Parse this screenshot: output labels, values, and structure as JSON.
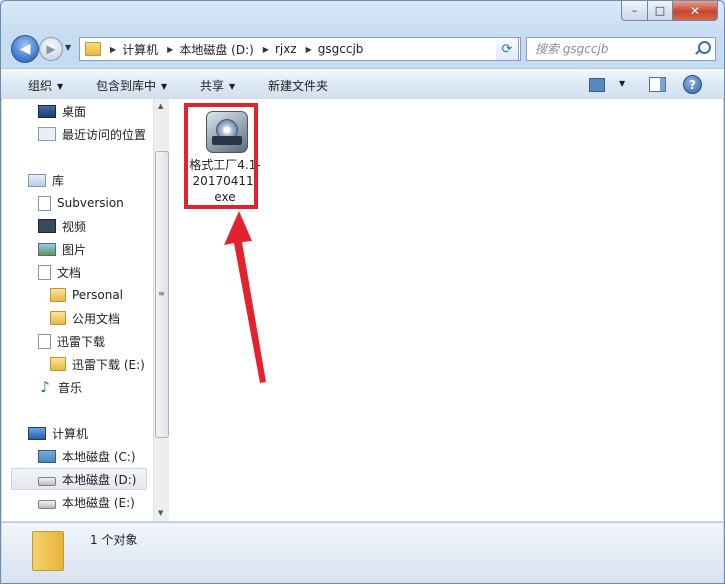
{
  "window": {
    "caption_min": "–",
    "caption_max": "□",
    "caption_close": "✕"
  },
  "nav": {
    "back": "◀",
    "forward": "▶",
    "breadcrumbs": [
      "计算机",
      "本地磁盘 (D:)",
      "rjxz",
      "gsgccjb"
    ],
    "search_placeholder": "搜索 gsgccjb"
  },
  "toolbar": {
    "organize": "组织",
    "include_in_library": "包含到库中",
    "share": "共享",
    "new_folder": "新建文件夹"
  },
  "sidebar": {
    "items": [
      {
        "label": "桌面",
        "icon": "desktop-icon"
      },
      {
        "label": "最近访问的位置",
        "icon": "recent-places-icon"
      },
      {
        "label": "库",
        "icon": "library-icon"
      },
      {
        "label": "Subversion",
        "icon": "document-icon"
      },
      {
        "label": "视频",
        "icon": "video-icon"
      },
      {
        "label": "图片",
        "icon": "picture-icon"
      },
      {
        "label": "文档",
        "icon": "document-icon"
      },
      {
        "label": "Personal",
        "icon": "folder-icon"
      },
      {
        "label": "公用文档",
        "icon": "folder-icon"
      },
      {
        "label": "迅雷下载",
        "icon": "document-icon"
      },
      {
        "label": "迅雷下载 (E:)",
        "icon": "folder-icon"
      },
      {
        "label": "音乐",
        "icon": "music-icon"
      },
      {
        "label": "计算机",
        "icon": "computer-icon"
      },
      {
        "label": "本地磁盘 (C:)",
        "icon": "drive-c-icon"
      },
      {
        "label": "本地磁盘 (D:)",
        "icon": "drive-icon"
      },
      {
        "label": "本地磁盘 (E:)",
        "icon": "drive-icon"
      }
    ],
    "selected": "本地磁盘 (D:)"
  },
  "files": [
    {
      "name": "格式工厂4.1-20170411.exe",
      "icon": "format-factory-app-icon"
    }
  ],
  "status": {
    "text": "1 个对象"
  },
  "annotation": {
    "highlight_color": "#e4222d"
  }
}
